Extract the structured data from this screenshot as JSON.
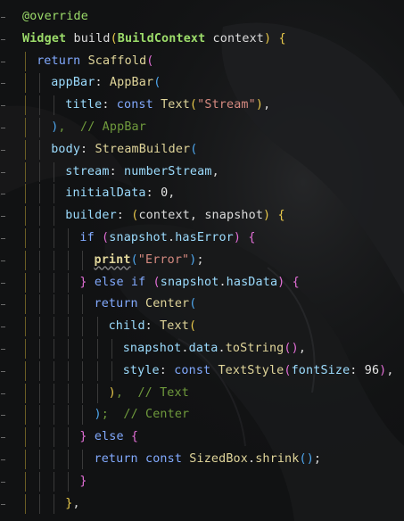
{
  "colors": {
    "background": "#111213",
    "annotation": "#9cdc6a",
    "keyword": "#82aaff",
    "identifier": "#dcdcdc",
    "string": "#d68a80",
    "number": "#e6e6e6",
    "comment": "#6f9a3c",
    "property": "#9cdcfe",
    "fn": "#e0d59a",
    "bracket_gold": "#e8c84a",
    "bracket_pink": "#e36fd7",
    "bracket_blue": "#4fa8f0",
    "guide": "#3a3a3a",
    "guide_active": "#6b5e24"
  },
  "code": {
    "lines": [
      {
        "indent": 0,
        "tokens": [
          {
            "t": "@override",
            "c": "annotation"
          }
        ]
      },
      {
        "indent": 0,
        "tokens": [
          {
            "t": "Widget",
            "c": "annotation",
            "b": true
          },
          {
            "t": " build",
            "c": "identifier"
          },
          {
            "t": "(",
            "c": "bracket_gold"
          },
          {
            "t": "BuildContext",
            "c": "annotation",
            "b": true
          },
          {
            "t": " context",
            "c": "identifier"
          },
          {
            "t": ")",
            "c": "bracket_gold"
          },
          {
            "t": " {",
            "c": "bracket_gold"
          }
        ]
      },
      {
        "indent": 1,
        "tokens": [
          {
            "t": "return",
            "c": "keyword"
          },
          {
            "t": " Scaffold",
            "c": "fn"
          },
          {
            "t": "(",
            "c": "bracket_pink"
          }
        ]
      },
      {
        "indent": 2,
        "tokens": [
          {
            "t": "appBar",
            "c": "property"
          },
          {
            "t": ": ",
            "c": "identifier"
          },
          {
            "t": "AppBar",
            "c": "fn"
          },
          {
            "t": "(",
            "c": "bracket_blue"
          }
        ]
      },
      {
        "indent": 3,
        "tokens": [
          {
            "t": "title",
            "c": "property"
          },
          {
            "t": ": ",
            "c": "identifier"
          },
          {
            "t": "const",
            "c": "keyword"
          },
          {
            "t": " Text",
            "c": "fn"
          },
          {
            "t": "(",
            "c": "bracket_gold"
          },
          {
            "t": "\"Stream\"",
            "c": "string"
          },
          {
            "t": ")",
            "c": "bracket_gold"
          },
          {
            "t": ",",
            "c": "identifier"
          }
        ]
      },
      {
        "indent": 2,
        "tokens": [
          {
            "t": ")",
            "c": "bracket_blue"
          },
          {
            "t": ",  // AppBar",
            "c": "comment"
          }
        ]
      },
      {
        "indent": 2,
        "tokens": [
          {
            "t": "body",
            "c": "property"
          },
          {
            "t": ": ",
            "c": "identifier"
          },
          {
            "t": "StreamBuilder",
            "c": "fn"
          },
          {
            "t": "(",
            "c": "bracket_blue"
          }
        ]
      },
      {
        "indent": 3,
        "tokens": [
          {
            "t": "stream",
            "c": "property"
          },
          {
            "t": ": ",
            "c": "identifier"
          },
          {
            "t": "numberStream",
            "c": "property"
          },
          {
            "t": ",",
            "c": "identifier"
          }
        ]
      },
      {
        "indent": 3,
        "tokens": [
          {
            "t": "initialData",
            "c": "property"
          },
          {
            "t": ": ",
            "c": "identifier"
          },
          {
            "t": "0",
            "c": "number"
          },
          {
            "t": ",",
            "c": "identifier"
          }
        ]
      },
      {
        "indent": 3,
        "tokens": [
          {
            "t": "builder",
            "c": "property"
          },
          {
            "t": ": ",
            "c": "identifier"
          },
          {
            "t": "(",
            "c": "bracket_gold"
          },
          {
            "t": "context, snapshot",
            "c": "identifier"
          },
          {
            "t": ")",
            "c": "bracket_gold"
          },
          {
            "t": " {",
            "c": "bracket_gold"
          }
        ]
      },
      {
        "indent": 4,
        "tokens": [
          {
            "t": "if",
            "c": "keyword"
          },
          {
            "t": " (",
            "c": "bracket_pink"
          },
          {
            "t": "snapshot",
            "c": "property"
          },
          {
            "t": ".",
            "c": "identifier"
          },
          {
            "t": "hasError",
            "c": "property"
          },
          {
            "t": ")",
            "c": "bracket_pink"
          },
          {
            "t": " {",
            "c": "bracket_pink"
          }
        ]
      },
      {
        "indent": 5,
        "tokens": [
          {
            "t": "print",
            "c": "fn",
            "b": true,
            "u": true
          },
          {
            "t": "(",
            "c": "bracket_blue"
          },
          {
            "t": "\"Error\"",
            "c": "string"
          },
          {
            "t": ")",
            "c": "bracket_blue"
          },
          {
            "t": ";",
            "c": "identifier"
          }
        ]
      },
      {
        "indent": 4,
        "tokens": [
          {
            "t": "}",
            "c": "bracket_pink"
          },
          {
            "t": " else if",
            "c": "keyword"
          },
          {
            "t": " (",
            "c": "bracket_pink"
          },
          {
            "t": "snapshot",
            "c": "property"
          },
          {
            "t": ".",
            "c": "identifier"
          },
          {
            "t": "hasData",
            "c": "property"
          },
          {
            "t": ")",
            "c": "bracket_pink"
          },
          {
            "t": " {",
            "c": "bracket_pink"
          }
        ]
      },
      {
        "indent": 5,
        "tokens": [
          {
            "t": "return",
            "c": "keyword"
          },
          {
            "t": " Center",
            "c": "fn"
          },
          {
            "t": "(",
            "c": "bracket_blue"
          }
        ]
      },
      {
        "indent": 6,
        "tokens": [
          {
            "t": "child",
            "c": "property"
          },
          {
            "t": ": ",
            "c": "identifier"
          },
          {
            "t": "Text",
            "c": "fn"
          },
          {
            "t": "(",
            "c": "bracket_gold"
          }
        ]
      },
      {
        "indent": 7,
        "tokens": [
          {
            "t": "snapshot",
            "c": "property"
          },
          {
            "t": ".",
            "c": "identifier"
          },
          {
            "t": "data",
            "c": "property"
          },
          {
            "t": ".",
            "c": "identifier"
          },
          {
            "t": "toString",
            "c": "fn"
          },
          {
            "t": "()",
            "c": "bracket_pink"
          },
          {
            "t": ",",
            "c": "identifier"
          }
        ]
      },
      {
        "indent": 7,
        "tokens": [
          {
            "t": "style",
            "c": "property"
          },
          {
            "t": ": ",
            "c": "identifier"
          },
          {
            "t": "const",
            "c": "keyword"
          },
          {
            "t": " TextStyle",
            "c": "fn"
          },
          {
            "t": "(",
            "c": "bracket_pink"
          },
          {
            "t": "fontSize",
            "c": "property"
          },
          {
            "t": ": ",
            "c": "identifier"
          },
          {
            "t": "96",
            "c": "number"
          },
          {
            "t": ")",
            "c": "bracket_pink"
          },
          {
            "t": ",",
            "c": "identifier"
          }
        ]
      },
      {
        "indent": 6,
        "tokens": [
          {
            "t": ")",
            "c": "bracket_gold"
          },
          {
            "t": ",  // Text",
            "c": "comment"
          }
        ]
      },
      {
        "indent": 5,
        "tokens": [
          {
            "t": ")",
            "c": "bracket_blue"
          },
          {
            "t": ";  // Center",
            "c": "comment"
          }
        ]
      },
      {
        "indent": 4,
        "tokens": [
          {
            "t": "}",
            "c": "bracket_pink"
          },
          {
            "t": " else",
            "c": "keyword"
          },
          {
            "t": " {",
            "c": "bracket_pink"
          }
        ]
      },
      {
        "indent": 5,
        "tokens": [
          {
            "t": "return",
            "c": "keyword"
          },
          {
            "t": " const",
            "c": "keyword"
          },
          {
            "t": " SizedBox",
            "c": "fn"
          },
          {
            "t": ".",
            "c": "identifier"
          },
          {
            "t": "shrink",
            "c": "fn"
          },
          {
            "t": "()",
            "c": "bracket_blue"
          },
          {
            "t": ";",
            "c": "identifier"
          }
        ]
      },
      {
        "indent": 4,
        "tokens": [
          {
            "t": "}",
            "c": "bracket_pink"
          }
        ]
      },
      {
        "indent": 3,
        "tokens": [
          {
            "t": "}",
            "c": "bracket_gold"
          },
          {
            "t": ",",
            "c": "identifier"
          }
        ]
      }
    ]
  }
}
